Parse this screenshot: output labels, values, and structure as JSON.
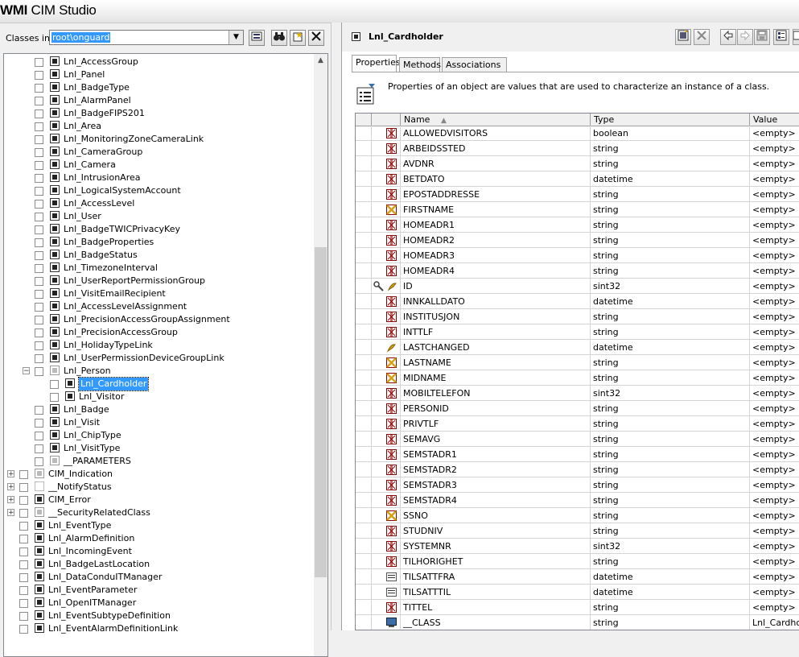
{
  "app": {
    "title_bold": "WMI",
    "title_rest": " CIM Studio"
  },
  "left": {
    "classes_label": "Classes in:",
    "namespace": "root\\onguard",
    "tree": [
      {
        "label": "Lnl_AccessGroup",
        "depth": 2,
        "icon": "class"
      },
      {
        "label": "Lnl_Panel",
        "depth": 2,
        "icon": "class"
      },
      {
        "label": "Lnl_BadgeType",
        "depth": 2,
        "icon": "class"
      },
      {
        "label": "Lnl_AlarmPanel",
        "depth": 2,
        "icon": "class"
      },
      {
        "label": "Lnl_BadgeFIPS201",
        "depth": 2,
        "icon": "class"
      },
      {
        "label": "Lnl_Area",
        "depth": 2,
        "icon": "class"
      },
      {
        "label": "Lnl_MonitoringZoneCameraLink",
        "depth": 2,
        "icon": "class"
      },
      {
        "label": "Lnl_CameraGroup",
        "depth": 2,
        "icon": "class"
      },
      {
        "label": "Lnl_Camera",
        "depth": 2,
        "icon": "class"
      },
      {
        "label": "Lnl_IntrusionArea",
        "depth": 2,
        "icon": "class"
      },
      {
        "label": "Lnl_LogicalSystemAccount",
        "depth": 2,
        "icon": "class"
      },
      {
        "label": "Lnl_AccessLevel",
        "depth": 2,
        "icon": "class"
      },
      {
        "label": "Lnl_User",
        "depth": 2,
        "icon": "class"
      },
      {
        "label": "Lnl_BadgeTWICPrivacyKey",
        "depth": 2,
        "icon": "class"
      },
      {
        "label": "Lnl_BadgeProperties",
        "depth": 2,
        "icon": "class"
      },
      {
        "label": "Lnl_BadgeStatus",
        "depth": 2,
        "icon": "class"
      },
      {
        "label": "Lnl_TimezoneInterval",
        "depth": 2,
        "icon": "class"
      },
      {
        "label": "Lnl_UserReportPermissionGroup",
        "depth": 2,
        "icon": "class"
      },
      {
        "label": "Lnl_VisitEmailRecipient",
        "depth": 2,
        "icon": "class"
      },
      {
        "label": "Lnl_AccessLevelAssignment",
        "depth": 2,
        "icon": "class"
      },
      {
        "label": "Lnl_PrecisionAccessGroupAssignment",
        "depth": 2,
        "icon": "class"
      },
      {
        "label": "Lnl_PrecisionAccessGroup",
        "depth": 2,
        "icon": "class"
      },
      {
        "label": "Lnl_HolidayTypeLink",
        "depth": 2,
        "icon": "class"
      },
      {
        "label": "Lnl_UserPermissionDeviceGroupLink",
        "depth": 2,
        "icon": "class"
      },
      {
        "label": "Lnl_Person",
        "depth": 2,
        "icon": "gray",
        "expander": "−"
      },
      {
        "label": "Lnl_Cardholder",
        "depth": 3,
        "icon": "class",
        "selected": true
      },
      {
        "label": "Lnl_Visitor",
        "depth": 3,
        "icon": "class"
      },
      {
        "label": "Lnl_Badge",
        "depth": 2,
        "icon": "class"
      },
      {
        "label": "Lnl_Visit",
        "depth": 2,
        "icon": "class"
      },
      {
        "label": "Lnl_ChipType",
        "depth": 2,
        "icon": "class"
      },
      {
        "label": "Lnl_VisitType",
        "depth": 2,
        "icon": "class"
      },
      {
        "label": "__PARAMETERS",
        "depth": 1,
        "icon": "gray"
      },
      {
        "label": "CIM_Indication",
        "depth": 0,
        "icon": "gray",
        "expander": "+"
      },
      {
        "label": "__NotifyStatus",
        "depth": 0,
        "icon": "none",
        "expander": "+"
      },
      {
        "label": "CIM_Error",
        "depth": 0,
        "icon": "class",
        "expander": "+"
      },
      {
        "label": "__SecurityRelatedClass",
        "depth": 0,
        "icon": "gray",
        "expander": "+"
      },
      {
        "label": "Lnl_EventType",
        "depth": 0,
        "icon": "class"
      },
      {
        "label": "Lnl_AlarmDefinition",
        "depth": 0,
        "icon": "class"
      },
      {
        "label": "Lnl_IncomingEvent",
        "depth": 0,
        "icon": "class"
      },
      {
        "label": "Lnl_BadgeLastLocation",
        "depth": 0,
        "icon": "class"
      },
      {
        "label": "Lnl_DataConduITManager",
        "depth": 0,
        "icon": "class"
      },
      {
        "label": "Lnl_EventParameter",
        "depth": 0,
        "icon": "class"
      },
      {
        "label": "Lnl_OpenITManager",
        "depth": 0,
        "icon": "class"
      },
      {
        "label": "Lnl_EventSubtypeDefinition",
        "depth": 0,
        "icon": "class"
      },
      {
        "label": "Lnl_EventAlarmDefinitionLink",
        "depth": 0,
        "icon": "class"
      }
    ]
  },
  "right": {
    "class_name": "Lnl_Cardholder",
    "tabs": [
      "Properties",
      "Methods",
      "Associations"
    ],
    "info_text": "Properties of an object are values that are used to characterize an instance of a class.",
    "columns": {
      "name": "Name",
      "type": "Type",
      "value": "Value"
    },
    "properties": [
      {
        "name": "ALLOWEDVISITORS",
        "type": "boolean",
        "value": "<empty>",
        "icon": "prop"
      },
      {
        "name": "ARBEIDSSTED",
        "type": "string",
        "value": "<empty>",
        "icon": "prop"
      },
      {
        "name": "AVDNR",
        "type": "string",
        "value": "<empty>",
        "icon": "prop"
      },
      {
        "name": "BETDATO",
        "type": "datetime",
        "value": "<empty>",
        "icon": "prop"
      },
      {
        "name": "EPOSTADDRESSE",
        "type": "string",
        "value": "<empty>",
        "icon": "prop"
      },
      {
        "name": "FIRSTNAME",
        "type": "string",
        "value": "<empty>",
        "icon": "prop-required"
      },
      {
        "name": "HOMEADR1",
        "type": "string",
        "value": "<empty>",
        "icon": "prop"
      },
      {
        "name": "HOMEADR2",
        "type": "string",
        "value": "<empty>",
        "icon": "prop"
      },
      {
        "name": "HOMEADR3",
        "type": "string",
        "value": "<empty>",
        "icon": "prop"
      },
      {
        "name": "HOMEADR4",
        "type": "string",
        "value": "<empty>",
        "icon": "prop"
      },
      {
        "name": "ID",
        "type": "sint32",
        "value": "<empty>",
        "icon": "key"
      },
      {
        "name": "INNKALLDATO",
        "type": "datetime",
        "value": "<empty>",
        "icon": "prop"
      },
      {
        "name": "INSTITUSJON",
        "type": "string",
        "value": "<empty>",
        "icon": "prop"
      },
      {
        "name": "INTTLF",
        "type": "string",
        "value": "<empty>",
        "icon": "prop"
      },
      {
        "name": "LASTCHANGED",
        "type": "datetime",
        "value": "<empty>",
        "icon": "readonly"
      },
      {
        "name": "LASTNAME",
        "type": "string",
        "value": "<empty>",
        "icon": "prop-required"
      },
      {
        "name": "MIDNAME",
        "type": "string",
        "value": "<empty>",
        "icon": "prop-required"
      },
      {
        "name": "MOBILTELEFON",
        "type": "sint32",
        "value": "<empty>",
        "icon": "prop"
      },
      {
        "name": "PERSONID",
        "type": "string",
        "value": "<empty>",
        "icon": "prop"
      },
      {
        "name": "PRIVTLF",
        "type": "string",
        "value": "<empty>",
        "icon": "prop"
      },
      {
        "name": "SEMAVG",
        "type": "string",
        "value": "<empty>",
        "icon": "prop"
      },
      {
        "name": "SEMSTADR1",
        "type": "string",
        "value": "<empty>",
        "icon": "prop"
      },
      {
        "name": "SEMSTADR2",
        "type": "string",
        "value": "<empty>",
        "icon": "prop"
      },
      {
        "name": "SEMSTADR3",
        "type": "string",
        "value": "<empty>",
        "icon": "prop"
      },
      {
        "name": "SEMSTADR4",
        "type": "string",
        "value": "<empty>",
        "icon": "prop"
      },
      {
        "name": "SSNO",
        "type": "string",
        "value": "<empty>",
        "icon": "prop-required"
      },
      {
        "name": "STUDNIV",
        "type": "string",
        "value": "<empty>",
        "icon": "prop"
      },
      {
        "name": "SYSTEMNR",
        "type": "sint32",
        "value": "<empty>",
        "icon": "prop"
      },
      {
        "name": "TILHORIGHET",
        "type": "string",
        "value": "<empty>",
        "icon": "prop"
      },
      {
        "name": "TILSATTFRA",
        "type": "datetime",
        "value": "<empty>",
        "icon": "system"
      },
      {
        "name": "TILSATTTIL",
        "type": "datetime",
        "value": "<empty>",
        "icon": "system"
      },
      {
        "name": "TITTEL",
        "type": "string",
        "value": "<empty>",
        "icon": "prop"
      },
      {
        "name": "__CLASS",
        "type": "string",
        "value": "Lnl_Cardholder",
        "icon": "system-class"
      }
    ]
  },
  "colors": {
    "selection": "#3399ff",
    "panel": "#f0f0f0",
    "prop_icon": "#8b0000",
    "required_icon": "#d4a017"
  }
}
